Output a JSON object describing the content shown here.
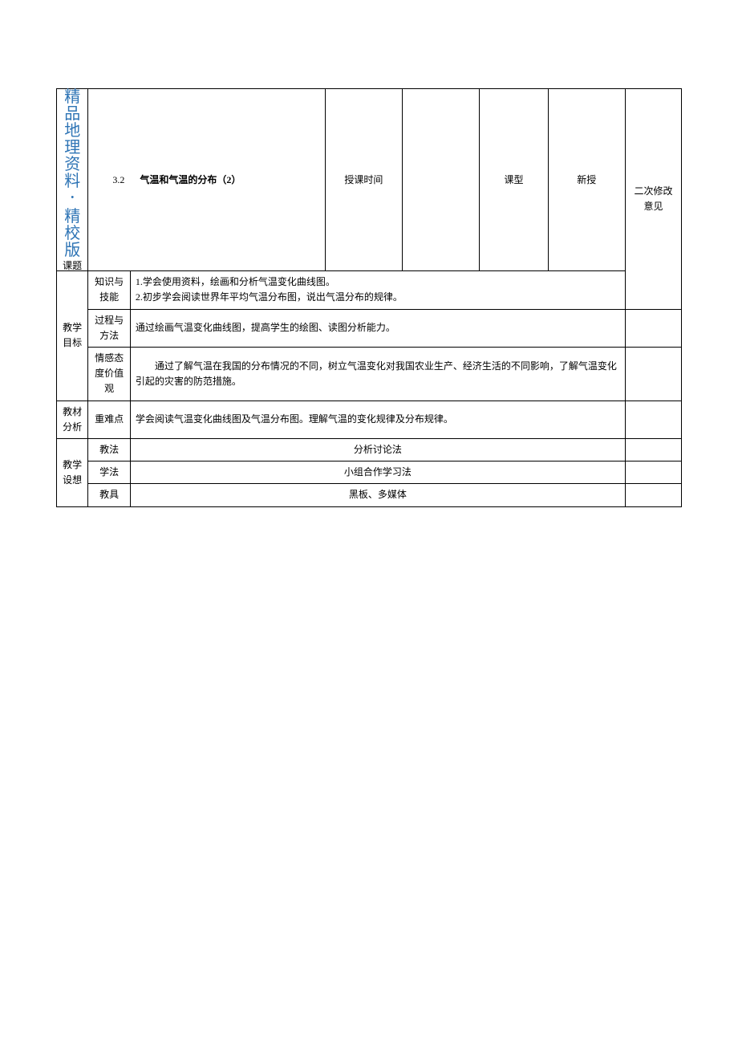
{
  "watermark": {
    "lines": [
      "精",
      "品",
      "地",
      "理",
      "资",
      "料",
      "・",
      "精",
      "校",
      "版"
    ],
    "topic_label": "课题"
  },
  "header": {
    "section_number": "3.2",
    "title": "气温和气温的分布（2）",
    "time_label": "授课时间",
    "time_value": "",
    "type_label": "课型",
    "type_value": "新授",
    "notes_label": "二次修改意见"
  },
  "goals": {
    "label": "教学目标",
    "rows": [
      {
        "sub_label": "知识与技能",
        "content_lines": [
          "1.学会使用资料，绘画和分析气温变化曲线图。",
          "2.初步学会阅读世界年平均气温分布图，说出气温分布的规律。"
        ]
      },
      {
        "sub_label": "过程与方法",
        "content": "通过绘画气温变化曲线图，提高学生的绘图、读图分析能力。"
      },
      {
        "sub_label": "情感态度价值观",
        "content": "通过了解气温在我国的分布情况的不同，树立气温变化对我国农业生产、经济生活的不同影响，了解气温变化引起的灾害的防范措施。"
      }
    ]
  },
  "material": {
    "label": "教材分析",
    "sub_label": "重难点",
    "content": "学会阅读气温变化曲线图及气温分布图。理解气温的变化规律及分布规律。"
  },
  "design": {
    "label": "教学设想",
    "rows": [
      {
        "sub_label": "教法",
        "content": "分析讨论法"
      },
      {
        "sub_label": "学法",
        "content": "小组合作学习法"
      },
      {
        "sub_label": "教具",
        "content": "黑板、多媒体"
      }
    ]
  }
}
